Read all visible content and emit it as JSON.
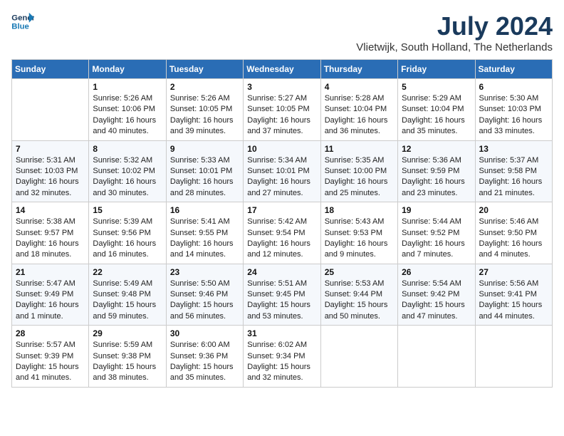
{
  "header": {
    "logo_line1": "General",
    "logo_line2": "Blue",
    "month": "July 2024",
    "location": "Vlietwijk, South Holland, The Netherlands"
  },
  "weekdays": [
    "Sunday",
    "Monday",
    "Tuesday",
    "Wednesday",
    "Thursday",
    "Friday",
    "Saturday"
  ],
  "weeks": [
    [
      {
        "day": "",
        "info": ""
      },
      {
        "day": "1",
        "info": "Sunrise: 5:26 AM\nSunset: 10:06 PM\nDaylight: 16 hours\nand 40 minutes."
      },
      {
        "day": "2",
        "info": "Sunrise: 5:26 AM\nSunset: 10:05 PM\nDaylight: 16 hours\nand 39 minutes."
      },
      {
        "day": "3",
        "info": "Sunrise: 5:27 AM\nSunset: 10:05 PM\nDaylight: 16 hours\nand 37 minutes."
      },
      {
        "day": "4",
        "info": "Sunrise: 5:28 AM\nSunset: 10:04 PM\nDaylight: 16 hours\nand 36 minutes."
      },
      {
        "day": "5",
        "info": "Sunrise: 5:29 AM\nSunset: 10:04 PM\nDaylight: 16 hours\nand 35 minutes."
      },
      {
        "day": "6",
        "info": "Sunrise: 5:30 AM\nSunset: 10:03 PM\nDaylight: 16 hours\nand 33 minutes."
      }
    ],
    [
      {
        "day": "7",
        "info": "Sunrise: 5:31 AM\nSunset: 10:03 PM\nDaylight: 16 hours\nand 32 minutes."
      },
      {
        "day": "8",
        "info": "Sunrise: 5:32 AM\nSunset: 10:02 PM\nDaylight: 16 hours\nand 30 minutes."
      },
      {
        "day": "9",
        "info": "Sunrise: 5:33 AM\nSunset: 10:01 PM\nDaylight: 16 hours\nand 28 minutes."
      },
      {
        "day": "10",
        "info": "Sunrise: 5:34 AM\nSunset: 10:01 PM\nDaylight: 16 hours\nand 27 minutes."
      },
      {
        "day": "11",
        "info": "Sunrise: 5:35 AM\nSunset: 10:00 PM\nDaylight: 16 hours\nand 25 minutes."
      },
      {
        "day": "12",
        "info": "Sunrise: 5:36 AM\nSunset: 9:59 PM\nDaylight: 16 hours\nand 23 minutes."
      },
      {
        "day": "13",
        "info": "Sunrise: 5:37 AM\nSunset: 9:58 PM\nDaylight: 16 hours\nand 21 minutes."
      }
    ],
    [
      {
        "day": "14",
        "info": "Sunrise: 5:38 AM\nSunset: 9:57 PM\nDaylight: 16 hours\nand 18 minutes."
      },
      {
        "day": "15",
        "info": "Sunrise: 5:39 AM\nSunset: 9:56 PM\nDaylight: 16 hours\nand 16 minutes."
      },
      {
        "day": "16",
        "info": "Sunrise: 5:41 AM\nSunset: 9:55 PM\nDaylight: 16 hours\nand 14 minutes."
      },
      {
        "day": "17",
        "info": "Sunrise: 5:42 AM\nSunset: 9:54 PM\nDaylight: 16 hours\nand 12 minutes."
      },
      {
        "day": "18",
        "info": "Sunrise: 5:43 AM\nSunset: 9:53 PM\nDaylight: 16 hours\nand 9 minutes."
      },
      {
        "day": "19",
        "info": "Sunrise: 5:44 AM\nSunset: 9:52 PM\nDaylight: 16 hours\nand 7 minutes."
      },
      {
        "day": "20",
        "info": "Sunrise: 5:46 AM\nSunset: 9:50 PM\nDaylight: 16 hours\nand 4 minutes."
      }
    ],
    [
      {
        "day": "21",
        "info": "Sunrise: 5:47 AM\nSunset: 9:49 PM\nDaylight: 16 hours\nand 1 minute."
      },
      {
        "day": "22",
        "info": "Sunrise: 5:49 AM\nSunset: 9:48 PM\nDaylight: 15 hours\nand 59 minutes."
      },
      {
        "day": "23",
        "info": "Sunrise: 5:50 AM\nSunset: 9:46 PM\nDaylight: 15 hours\nand 56 minutes."
      },
      {
        "day": "24",
        "info": "Sunrise: 5:51 AM\nSunset: 9:45 PM\nDaylight: 15 hours\nand 53 minutes."
      },
      {
        "day": "25",
        "info": "Sunrise: 5:53 AM\nSunset: 9:44 PM\nDaylight: 15 hours\nand 50 minutes."
      },
      {
        "day": "26",
        "info": "Sunrise: 5:54 AM\nSunset: 9:42 PM\nDaylight: 15 hours\nand 47 minutes."
      },
      {
        "day": "27",
        "info": "Sunrise: 5:56 AM\nSunset: 9:41 PM\nDaylight: 15 hours\nand 44 minutes."
      }
    ],
    [
      {
        "day": "28",
        "info": "Sunrise: 5:57 AM\nSunset: 9:39 PM\nDaylight: 15 hours\nand 41 minutes."
      },
      {
        "day": "29",
        "info": "Sunrise: 5:59 AM\nSunset: 9:38 PM\nDaylight: 15 hours\nand 38 minutes."
      },
      {
        "day": "30",
        "info": "Sunrise: 6:00 AM\nSunset: 9:36 PM\nDaylight: 15 hours\nand 35 minutes."
      },
      {
        "day": "31",
        "info": "Sunrise: 6:02 AM\nSunset: 9:34 PM\nDaylight: 15 hours\nand 32 minutes."
      },
      {
        "day": "",
        "info": ""
      },
      {
        "day": "",
        "info": ""
      },
      {
        "day": "",
        "info": ""
      }
    ]
  ]
}
